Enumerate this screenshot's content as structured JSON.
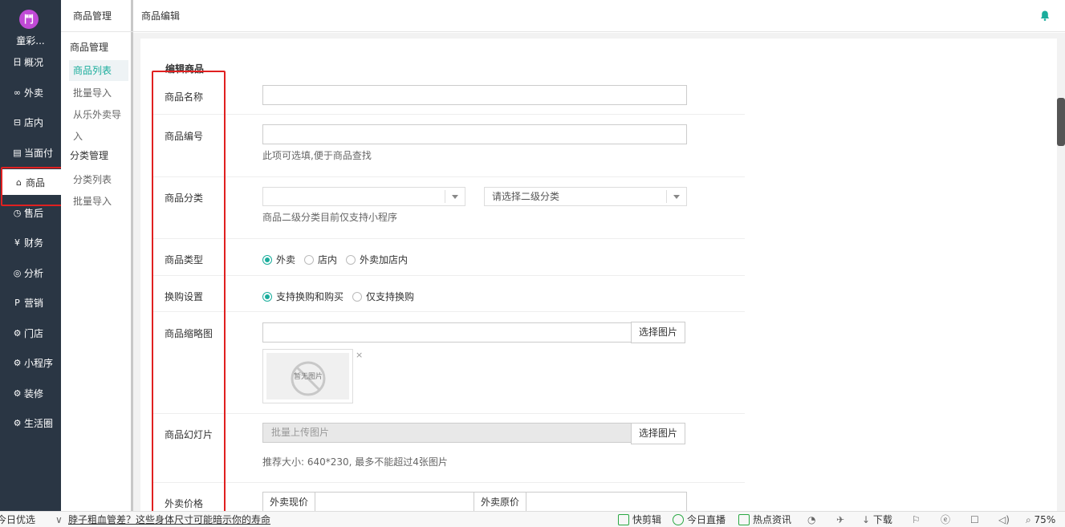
{
  "sidebar": {
    "logo_text": "鬥",
    "shop_name": "童彩...",
    "items": [
      {
        "icon": "日",
        "label": "概况"
      },
      {
        "icon": "∞",
        "label": "外卖"
      },
      {
        "icon": "⊟",
        "label": "店内"
      },
      {
        "icon": "▤",
        "label": "当面付"
      },
      {
        "icon": "⌂",
        "label": "商品"
      },
      {
        "icon": "◷",
        "label": "售后"
      },
      {
        "icon": "¥",
        "label": "财务"
      },
      {
        "icon": "◎",
        "label": "分析"
      },
      {
        "icon": "P",
        "label": "营销"
      },
      {
        "icon": "⚙",
        "label": "门店"
      },
      {
        "icon": "⚙",
        "label": "小程序"
      },
      {
        "icon": "⚙",
        "label": "装修"
      },
      {
        "icon": "⚙",
        "label": "生活圈"
      }
    ],
    "active_index": 4
  },
  "sub_sidebar": {
    "header": "商品管理",
    "group1": "商品管理",
    "item_list": "商品列表",
    "item_import": "批量导入",
    "item_from_other": "从乐外卖导",
    "item_from_other_2": "入",
    "group2": "分类管理",
    "cat_list": "分类列表",
    "cat_import": "批量导入"
  },
  "topbar": {
    "title": "商品编辑",
    "accent": "#1aad9c"
  },
  "form": {
    "section_title": "编辑商品",
    "name_label": "商品名称",
    "name_value": "",
    "code_label": "商品编号",
    "code_value": "",
    "code_help": "此项可选填,便于商品查找",
    "category_label": "商品分类",
    "category_primary": "",
    "category_secondary_placeholder": "请选择二级分类",
    "category_help": "商品二级分类目前仅支持小程序",
    "type_label": "商品类型",
    "type_options": [
      "外卖",
      "店内",
      "外卖加店内"
    ],
    "type_selected": 0,
    "exchange_label": "换购设置",
    "exchange_options": [
      "支持换购和购买",
      "仅支持换购"
    ],
    "exchange_selected": 0,
    "thumb_label": "商品缩略图",
    "thumb_value": "",
    "pick_image": "选择图片",
    "no_image": "暂无图片",
    "remove_mark": "×",
    "slides_label": "商品幻灯片",
    "slides_placeholder": "批量上传图片",
    "slides_help": "推荐大小: 640*230, 最多不能超过4张图片",
    "price_label": "外卖价格",
    "price_current": "外卖现价",
    "price_original": "外卖原价"
  },
  "statusbar": {
    "left": "今日优选",
    "headline": "脖子粗血管差？这些身体尺寸可能暗示你的寿命",
    "items": [
      "快剪辑",
      "今日直播",
      "热点资讯"
    ],
    "download": "下载",
    "zoom": "75%"
  }
}
